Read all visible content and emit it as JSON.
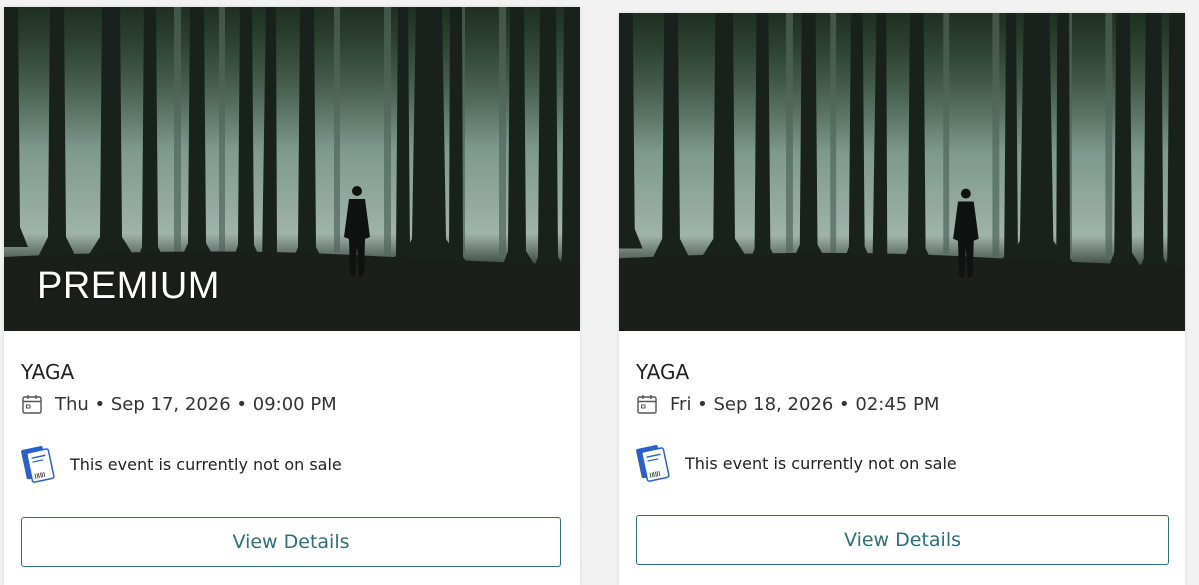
{
  "events": [
    {
      "badge": "PREMIUM",
      "title": "YAGA",
      "date": "Thu • Sep 17, 2026 • 09:00 PM",
      "sale_status": "This event is currently not on sale",
      "button_label": "View Details"
    },
    {
      "title": "YAGA",
      "date": "Fri • Sep 18, 2026 • 02:45 PM",
      "sale_status": "This event is currently not on sale",
      "button_label": "View Details"
    }
  ],
  "icons": {
    "calendar": "calendar-icon",
    "ticket": "ticket-icon"
  },
  "colors": {
    "accent": "#2f6f77",
    "ticket_blue": "#2b5fcf"
  }
}
